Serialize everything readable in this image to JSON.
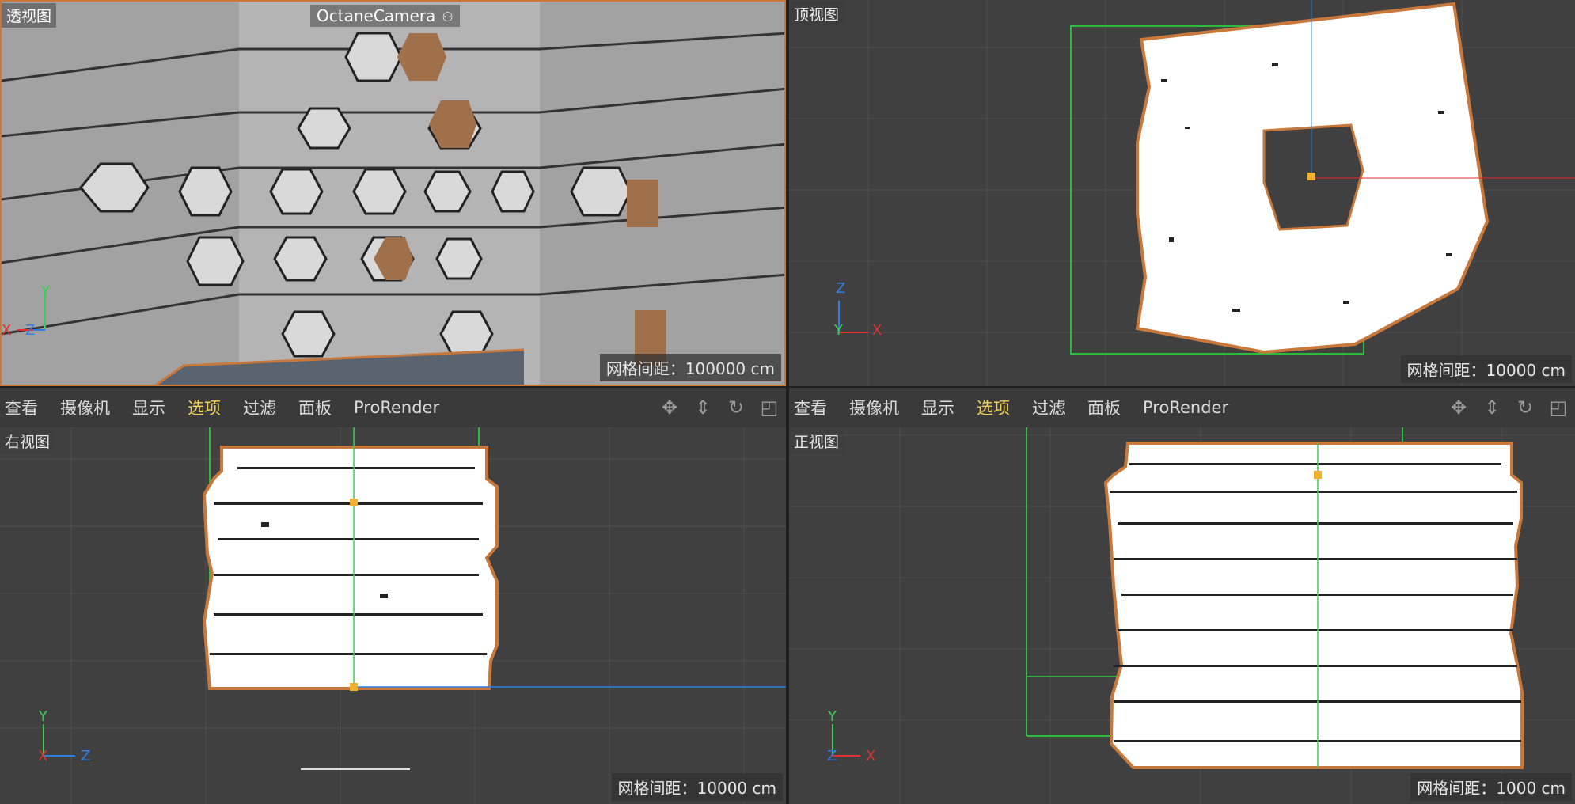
{
  "viewports": {
    "perspective": {
      "label": "透视图",
      "camera": "OctaneCamera",
      "grid": "网格间距：100000 cm"
    },
    "top": {
      "label": "顶视图",
      "grid": "网格间距：10000 cm"
    },
    "right": {
      "label": "右视图",
      "grid": "网格间距：10000 cm"
    },
    "front": {
      "label": "正视图",
      "grid": "网格间距：1000 cm"
    }
  },
  "menu": {
    "items": [
      "查看",
      "摄像机",
      "显示",
      "选项",
      "过滤",
      "面板",
      "ProRender"
    ],
    "active": "选项"
  },
  "nav_icons": [
    "move-view-icon",
    "dolly-view-icon",
    "rotate-view-icon",
    "maximize-view-icon"
  ],
  "axes": {
    "x": "X",
    "y": "Y",
    "z": "Z"
  },
  "colors": {
    "selection": "#c8783a",
    "accent": "#f2d25a",
    "x_axis": "#e03030",
    "y_axis": "#3ccf55",
    "z_axis": "#2f7fe0"
  }
}
